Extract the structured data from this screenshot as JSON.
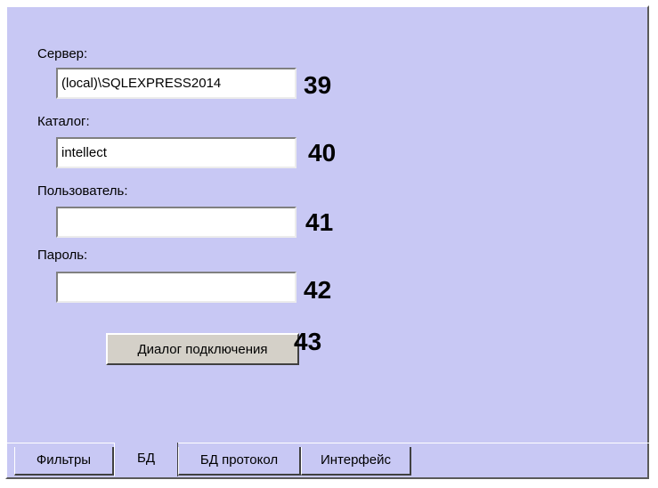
{
  "server": {
    "label": "Сервер:",
    "value": "(local)\\SQLEXPRESS2014",
    "marker": "39"
  },
  "catalog": {
    "label": "Каталог:",
    "value": "intellect",
    "marker": "40"
  },
  "user": {
    "label": "Пользователь:",
    "value": "",
    "marker": "41"
  },
  "password": {
    "label": "Пароль:",
    "value": "",
    "marker": "42"
  },
  "connect_button": {
    "label": "Диалог подключения",
    "marker": "43"
  },
  "tabs": [
    {
      "label": "Фильтры",
      "active": false
    },
    {
      "label": "БД",
      "active": true
    },
    {
      "label": "БД протокол",
      "active": false
    },
    {
      "label": "Интерфейс",
      "active": false
    }
  ],
  "colors": {
    "panel": "#c8c8f4",
    "button": "#d4d0c8"
  }
}
